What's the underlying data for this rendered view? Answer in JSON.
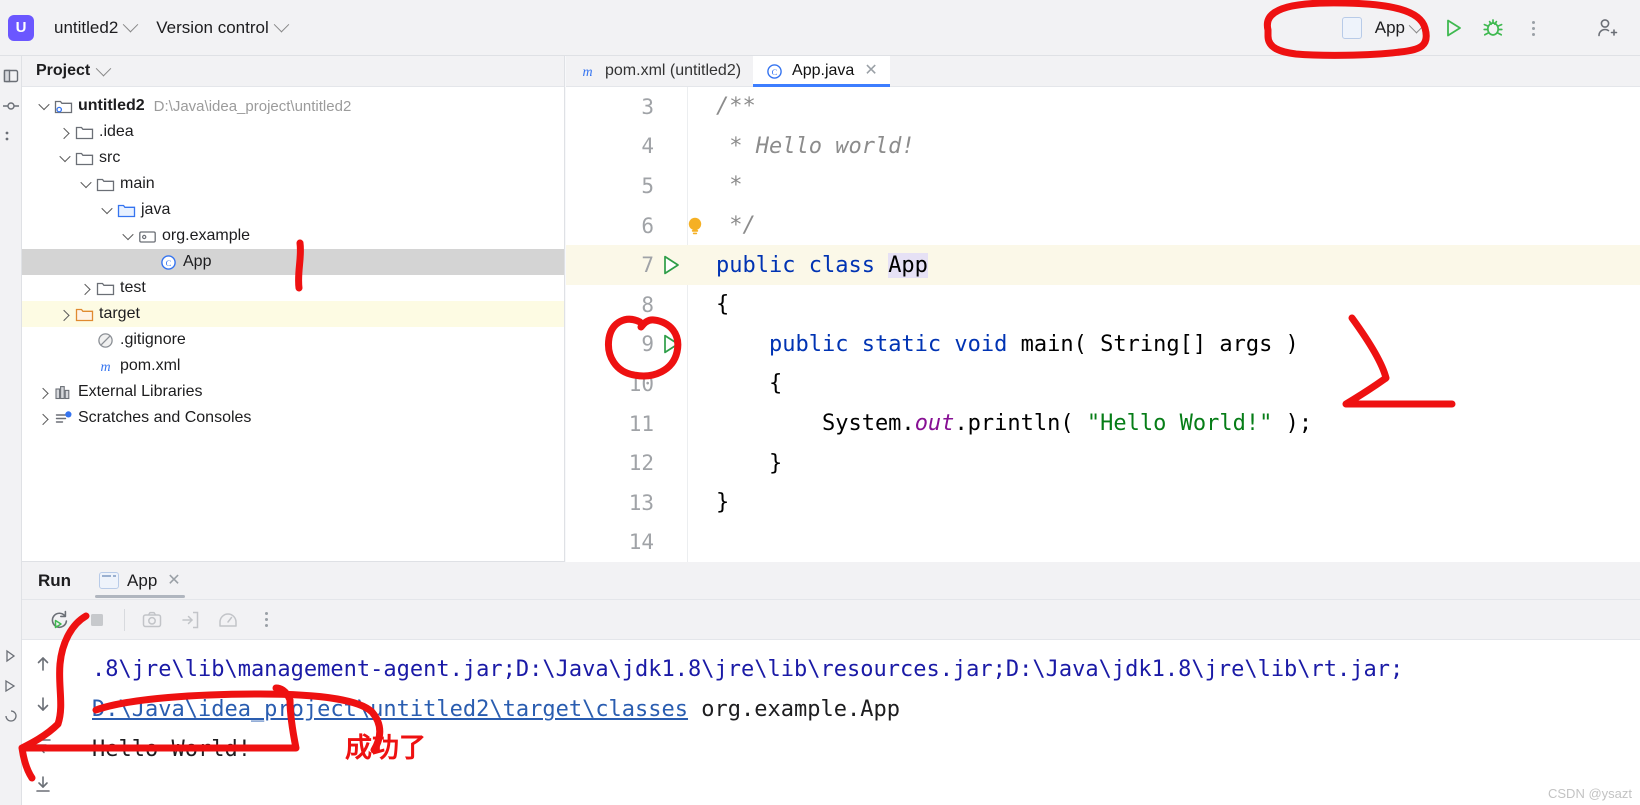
{
  "titlebar": {
    "project_badge": "U",
    "project_name": "untitled2",
    "version_control": "Version control",
    "run_config_name": "App",
    "icons": {
      "run": "run-icon",
      "debug": "debug-icon",
      "more": "more-vertical-icon",
      "share": "add-user-icon"
    }
  },
  "project_pane": {
    "header": "Project",
    "tree": [
      {
        "label": "untitled2",
        "path": "D:\\Java\\idea_project\\untitled2",
        "depth": 0,
        "arrow": "open",
        "icon": "module-icon",
        "bold": true,
        "state": "normal"
      },
      {
        "label": ".idea",
        "path": "",
        "depth": 1,
        "arrow": "closed",
        "icon": "folder-icon",
        "bold": false,
        "state": "normal"
      },
      {
        "label": "src",
        "path": "",
        "depth": 1,
        "arrow": "open",
        "icon": "folder-icon",
        "bold": false,
        "state": "normal"
      },
      {
        "label": "main",
        "path": "",
        "depth": 2,
        "arrow": "open",
        "icon": "folder-icon",
        "bold": false,
        "state": "normal"
      },
      {
        "label": "java",
        "path": "",
        "depth": 3,
        "arrow": "open",
        "icon": "source-folder-icon",
        "bold": false,
        "state": "normal"
      },
      {
        "label": "org.example",
        "path": "",
        "depth": 4,
        "arrow": "open",
        "icon": "package-icon",
        "bold": false,
        "state": "normal"
      },
      {
        "label": "App",
        "path": "",
        "depth": 5,
        "arrow": "none",
        "icon": "class-icon",
        "bold": false,
        "state": "selected"
      },
      {
        "label": "test",
        "path": "",
        "depth": 2,
        "arrow": "closed",
        "icon": "folder-icon",
        "bold": false,
        "state": "normal"
      },
      {
        "label": "target",
        "path": "",
        "depth": 1,
        "arrow": "closed",
        "icon": "excluded-folder-icon",
        "bold": false,
        "state": "excluded"
      },
      {
        "label": ".gitignore",
        "path": "",
        "depth": 2,
        "arrow": "none",
        "icon": "gitignore-icon",
        "bold": false,
        "state": "normal"
      },
      {
        "label": "pom.xml",
        "path": "",
        "depth": 2,
        "arrow": "none",
        "icon": "maven-icon",
        "bold": false,
        "state": "normal"
      },
      {
        "label": "External Libraries",
        "path": "",
        "depth": 0,
        "arrow": "closed",
        "icon": "library-icon",
        "bold": false,
        "state": "normal"
      },
      {
        "label": "Scratches and Consoles",
        "path": "",
        "depth": 0,
        "arrow": "closed",
        "icon": "scratches-icon",
        "bold": false,
        "state": "normal"
      }
    ]
  },
  "editor": {
    "tabs": [
      {
        "label": "pom.xml (untitled2)",
        "icon": "maven-icon",
        "active": false,
        "closable": false
      },
      {
        "label": "App.java",
        "icon": "class-icon",
        "active": true,
        "closable": true
      }
    ],
    "first_visible_line": 3,
    "lines": [
      {
        "num": "3",
        "gutter": "none",
        "highlight": false,
        "tokens": [
          {
            "t": "/**",
            "c": "cm"
          }
        ]
      },
      {
        "num": "4",
        "gutter": "none",
        "highlight": false,
        "tokens": [
          {
            "t": " * Hello world!",
            "c": "cm"
          }
        ]
      },
      {
        "num": "5",
        "gutter": "none",
        "highlight": false,
        "tokens": [
          {
            "t": " *",
            "c": "cm"
          }
        ]
      },
      {
        "num": "6",
        "gutter": "none",
        "highlight": false,
        "tokens": [
          {
            "t": " */",
            "c": "cm"
          }
        ],
        "bulb": true
      },
      {
        "num": "7",
        "gutter": "run",
        "highlight": true,
        "tokens": [
          {
            "t": "public class ",
            "c": "k"
          },
          {
            "t": "App",
            "c": "sel"
          }
        ]
      },
      {
        "num": "8",
        "gutter": "none",
        "highlight": false,
        "tokens": [
          {
            "t": "{",
            "c": "ty"
          }
        ]
      },
      {
        "num": "9",
        "gutter": "run",
        "highlight": false,
        "tokens": [
          {
            "t": "    ",
            "c": "ty"
          },
          {
            "t": "public static void ",
            "c": "k"
          },
          {
            "t": "main( String[] args )",
            "c": "ty"
          }
        ]
      },
      {
        "num": "10",
        "gutter": "none",
        "highlight": false,
        "tokens": [
          {
            "t": "    {",
            "c": "ty"
          }
        ]
      },
      {
        "num": "11",
        "gutter": "none",
        "highlight": false,
        "tokens": [
          {
            "t": "        System.",
            "c": "ty"
          },
          {
            "t": "out",
            "c": "fi"
          },
          {
            "t": ".println( ",
            "c": "ty"
          },
          {
            "t": "\"Hello World!\"",
            "c": "st"
          },
          {
            "t": " );",
            "c": "ty"
          }
        ]
      },
      {
        "num": "12",
        "gutter": "none",
        "highlight": false,
        "tokens": [
          {
            "t": "    }",
            "c": "ty"
          }
        ]
      },
      {
        "num": "13",
        "gutter": "none",
        "highlight": false,
        "tokens": [
          {
            "t": "}",
            "c": "ty"
          }
        ]
      },
      {
        "num": "14",
        "gutter": "none",
        "highlight": false,
        "tokens": [
          {
            "t": "",
            "c": "ty"
          }
        ]
      }
    ]
  },
  "run_panel": {
    "title": "Run",
    "tab_label": "App",
    "toolbar_icons": [
      "rerun-icon",
      "stop-icon",
      "screenshot-icon",
      "export-to-file-icon",
      "profiler-icon",
      "more-vertical-icon"
    ],
    "side_icons": [
      "scroll-up-icon",
      "scroll-down-icon",
      "soft-wrap-icon",
      "scroll-to-end-icon"
    ],
    "console": [
      {
        "segments": [
          {
            "t": ".8\\jre\\lib\\management-agent.jar;D:\\Java\\jdk1.8\\jre\\lib\\resources.jar;D:\\Java\\jdk1.8\\jre\\lib\\rt.jar;",
            "c": "c-blue"
          }
        ]
      },
      {
        "segments": [
          {
            "t": "D:\\Java\\idea_project\\untitled2\\target\\classes",
            "c": "c-link"
          },
          {
            "t": " org.example.App",
            "c": "c-plain"
          }
        ]
      },
      {
        "segments": [
          {
            "t": "Hello World!",
            "c": "c-plain"
          }
        ]
      }
    ]
  },
  "annotations": {
    "success_note": "成功了",
    "color": "#ee1111",
    "shapes": [
      "circle-around-run-config",
      "vertical-stroke-near-app-node",
      "circle-around-gutter-run-icon",
      "arrow-pointing-to-main-method",
      "bracket-around-console-output"
    ]
  },
  "watermark": "CSDN @ysazt"
}
